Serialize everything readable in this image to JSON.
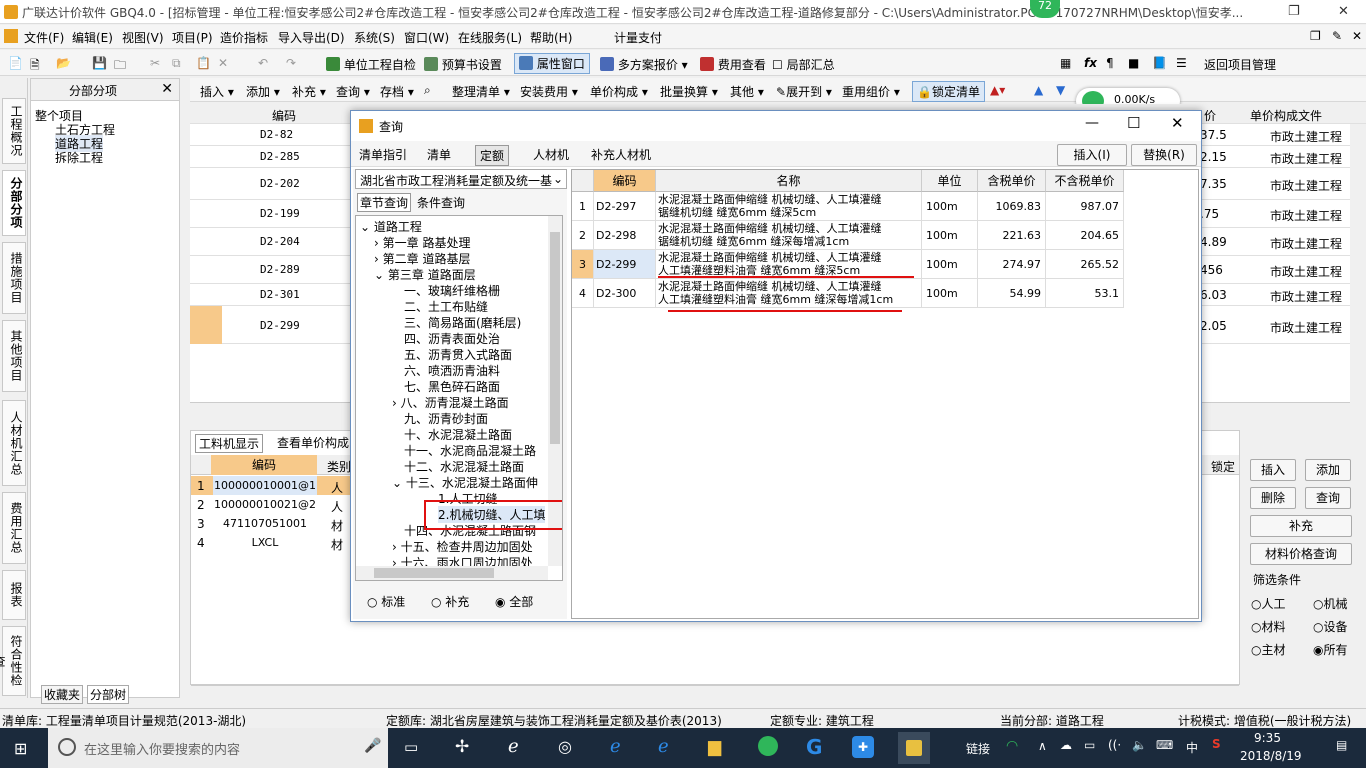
{
  "window": {
    "title": "广联达计价软件 GBQ4.0 - [招标管理 - 单位工程:恒安孝感公司2#仓库改造工程 - 恒安孝感公司2#仓库改造工程 - 恒安孝感公司2#仓库改造工程-道路修复部分 - C:\\Users\\Administrator.PC-20170727NRHM\\Desktop\\恒安孝...",
    "badge": "72"
  },
  "menu": [
    "文件(F)",
    "编辑(E)",
    "视图(V)",
    "项目(P)",
    "造价指标",
    "导入导出(D)",
    "系统(S)",
    "窗口(W)",
    "在线服务(L)",
    "帮助(H)",
    "计量支付"
  ],
  "toolbar": {
    "self_check": "单位工程自检",
    "budget_settings": "预算书设置",
    "attr_window": "属性窗口",
    "multi_plan": "多方案报价",
    "fee_view": "费用查看",
    "partial_summary": "局部汇总",
    "return_mgmt": "返回项目管理"
  },
  "toolbar2": [
    "插入",
    "添加",
    "补充",
    "查询",
    "存档",
    "整理清单",
    "安装费用",
    "单价构成",
    "批量换算",
    "其他",
    "展开到",
    "重用组价",
    "锁定清单"
  ],
  "network_speed": "0.00K/s",
  "side_tabs": [
    "工程概况",
    "分部分项",
    "措施项目",
    "其他项目",
    "人材机汇总",
    "费用汇总",
    "报表",
    "符合性检查"
  ],
  "fenbu": {
    "header": "分部分项",
    "root": "整个项目",
    "items": [
      "土石方工程",
      "道路工程",
      "拆除工程"
    ],
    "bottom_tabs": [
      "收藏夹",
      "分部树"
    ]
  },
  "main": {
    "header_code": "编码",
    "header_price": "价",
    "header_file": "单价构成文件",
    "rows": [
      {
        "code": "D2-82",
        "price": "37.5",
        "file": "市政土建工程"
      },
      {
        "code": "D2-285",
        "price": "2.15",
        "file": "市政土建工程"
      },
      {
        "code": "D2-202",
        "price": "7.35",
        "file": "市政土建工程"
      },
      {
        "code": "D2-199",
        "price": ".75",
        "file": "市政土建工程"
      },
      {
        "code": "D2-204",
        "price": "4.89",
        "file": "市政土建工程"
      },
      {
        "code": "D2-289",
        "price": "456",
        "file": "市政土建工程"
      },
      {
        "code": "D2-301",
        "price": "6.03",
        "file": "市政土建工程"
      },
      {
        "code": "D2-299",
        "price": "2.05",
        "file": "市政土建工程"
      }
    ]
  },
  "lower": {
    "tabs": [
      "工料机显示",
      "查看单价构成"
    ],
    "h_code": "编码",
    "h_type": "类别",
    "h_lock": "锁定",
    "rows": [
      {
        "n": "1",
        "code": "100000010001@1",
        "type": "人"
      },
      {
        "n": "2",
        "code": "100000010021@2",
        "type": "人"
      },
      {
        "n": "3",
        "code": "471107051001",
        "type": "材"
      },
      {
        "n": "4",
        "code": "LXCL",
        "type": "材"
      }
    ]
  },
  "right_panel": {
    "insert": "插入",
    "add": "添加",
    "delete": "删除",
    "query": "查询",
    "supplement": "补充",
    "price_query": "材料价格查询",
    "filter_title": "筛选条件",
    "filters": [
      "人工",
      "机械",
      "材料",
      "设备",
      "主材",
      "所有"
    ]
  },
  "status": {
    "list_lib": "清单库: 工程量清单项目计量规范(2013-湖北)",
    "quota_lib": "定额库: 湖北省房屋建筑与装饰工程消耗量定额及基价表(2013)",
    "quota_major": "定额专业: 建筑工程",
    "current": "当前分部: 道路工程",
    "tax_mode": "计税模式: 增值税(一般计税方法)"
  },
  "taskbar": {
    "search": "在这里输入你要搜索的内容",
    "link": "链接",
    "ime": "中",
    "time": "9:35",
    "date": "2018/8/19"
  },
  "dialog": {
    "title": "查询",
    "tabs": [
      "清单指引",
      "清单",
      "定额",
      "人材机",
      "补充人材机"
    ],
    "insert": "插入(I)",
    "replace": "替换(R)",
    "lib": "湖北省市政工程消耗量定额及统一基",
    "subtabs": [
      "章节查询",
      "条件查询"
    ],
    "tree": [
      "道路工程",
      "第一章 路基处理",
      "第二章  道路基层",
      "第三章 道路面层",
      "一、玻璃纤维格栅",
      "二、土工布贴缝",
      "三、简易路面(磨耗层)",
      "四、沥青表面处治",
      "五、沥青贯入式路面",
      "六、喷洒沥青油料",
      "七、黑色碎石路面",
      "八、沥青混凝土路面",
      "九、沥青砂封面",
      "十、水泥混凝土路面",
      "十一、水泥商品混凝土路",
      "十二、水泥混凝土路面",
      "十三、水泥混凝土路面伸",
      "1.人工切缝",
      "2.机械切缝、人工填",
      "十四、水泥混凝土路面钢",
      "十五、检查井周边加固处",
      "十六、雨水口周边加固处"
    ],
    "radios": [
      "标准",
      "补充",
      "全部"
    ],
    "headers": [
      "编码",
      "名称",
      "单位",
      "含税单价",
      "不含税单价"
    ],
    "rows": [
      {
        "n": "1",
        "code": "D2-297",
        "name1": "水泥混凝土路面伸缩缝 机械切缝、人工填灌缝",
        "name2": "锯缝机切缝 缝宽6mm 缝深5cm",
        "unit": "100m",
        "tax": "1069.83",
        "notax": "987.07"
      },
      {
        "n": "2",
        "code": "D2-298",
        "name1": "水泥混凝土路面伸缩缝 机械切缝、人工填灌缝",
        "name2": "锯缝机切缝 缝宽6mm 缝深每增减1cm",
        "unit": "100m",
        "tax": "221.63",
        "notax": "204.65"
      },
      {
        "n": "3",
        "code": "D2-299",
        "name1": "水泥混凝土路面伸缩缝 机械切缝、人工填灌缝",
        "name2": "人工填灌缝塑料油膏 缝宽6mm 缝深5cm",
        "unit": "100m",
        "tax": "274.97",
        "notax": "265.52"
      },
      {
        "n": "4",
        "code": "D2-300",
        "name1": "水泥混凝土路面伸缩缝 机械切缝、人工填灌缝",
        "name2": "人工填灌缝塑料油膏 缝宽6mm 缝深每增减1cm",
        "unit": "100m",
        "tax": "54.99",
        "notax": "53.1"
      }
    ]
  }
}
